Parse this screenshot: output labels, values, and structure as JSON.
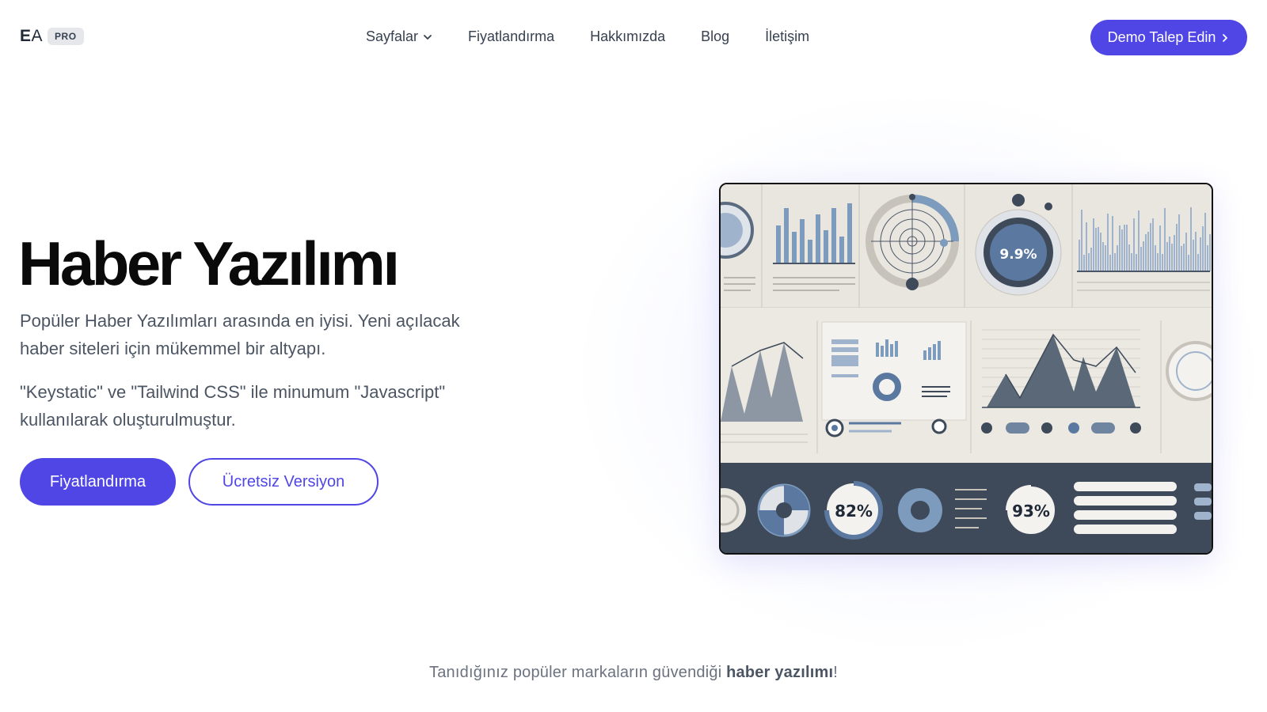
{
  "logo": {
    "mark_bold": "E",
    "mark_regular": "A",
    "badge": "PRO"
  },
  "nav": {
    "items": [
      {
        "label": "Sayfalar",
        "has_dropdown": true
      },
      {
        "label": "Fiyatlandırma"
      },
      {
        "label": "Hakkımızda"
      },
      {
        "label": "Blog"
      },
      {
        "label": "İletişim"
      }
    ],
    "cta_label": "Demo Talep Edin"
  },
  "hero": {
    "title": "Haber Yazılımı",
    "paragraph_1": "Popüler Haber Yazılımları arasında en iyisi. Yeni açılacak haber siteleri için mükemmel bir altyapı.",
    "paragraph_2": "\"Keystatic\" ve \"Tailwind CSS\" ile minumum \"Javascript\" kullanılarak oluşturulmuştur.",
    "primary_button": "Fiyatlandırma",
    "secondary_button": "Ücretsiz Versiyon"
  },
  "dashboard_image": {
    "readouts": [
      "9.9%",
      "82%",
      "93%"
    ]
  },
  "trusted": {
    "prefix": "Tanıdığınız popüler markaların güvendiği ",
    "emphasis": "haber yazılımı",
    "suffix": "!"
  },
  "colors": {
    "accent": "#4f46e5",
    "text_dark": "#0a0a0a",
    "text_muted": "#4b5563",
    "panel_bg": "#ece9e2",
    "panel_dark": "#3e4a5a",
    "chart_blue": "#7c9bbd"
  }
}
